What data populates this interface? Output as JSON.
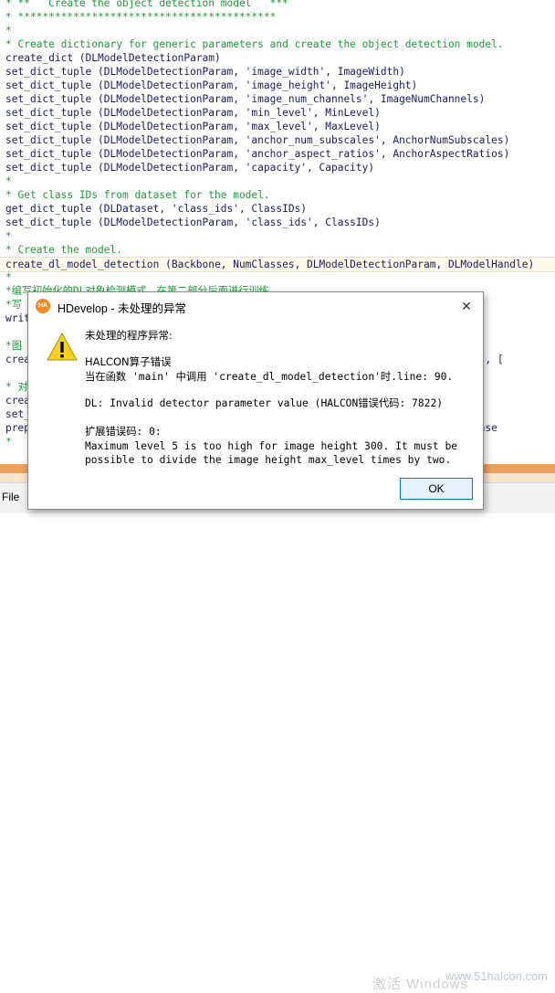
{
  "editor": {
    "lines": [
      {
        "text": "* **   Create the object detection model   ***",
        "kind": "c"
      },
      {
        "text": "* ******************************************",
        "kind": "c"
      },
      {
        "text": "*",
        "kind": "c"
      },
      {
        "text": "* Create dictionary for generic parameters and create the object detection model.",
        "kind": "c"
      },
      {
        "text": "create_dict (DLModelDetectionParam)",
        "kind": "n"
      },
      {
        "text": "set_dict_tuple (DLModelDetectionParam, 'image_width', ImageWidth)",
        "kind": "n"
      },
      {
        "text": "set_dict_tuple (DLModelDetectionParam, 'image_height', ImageHeight)",
        "kind": "n"
      },
      {
        "text": "set_dict_tuple (DLModelDetectionParam, 'image_num_channels', ImageNumChannels)",
        "kind": "n"
      },
      {
        "text": "set_dict_tuple (DLModelDetectionParam, 'min_level', MinLevel)",
        "kind": "n"
      },
      {
        "text": "set_dict_tuple (DLModelDetectionParam, 'max_level', MaxLevel)",
        "kind": "n"
      },
      {
        "text": "set_dict_tuple (DLModelDetectionParam, 'anchor_num_subscales', AnchorNumSubscales)",
        "kind": "n"
      },
      {
        "text": "set_dict_tuple (DLModelDetectionParam, 'anchor_aspect_ratios', AnchorAspectRatios)",
        "kind": "n"
      },
      {
        "text": "set_dict_tuple (DLModelDetectionParam, 'capacity', Capacity)",
        "kind": "n"
      },
      {
        "text": "*",
        "kind": "c"
      },
      {
        "text": "* Get class IDs from dataset for the model.",
        "kind": "c"
      },
      {
        "text": "get_dict_tuple (DLDataset, 'class_ids', ClassIDs)",
        "kind": "n"
      },
      {
        "text": "set_dict_tuple (DLModelDetectionParam, 'class_ids', ClassIDs)",
        "kind": "n"
      },
      {
        "text": "*",
        "kind": "c"
      },
      {
        "text": "* Create the model.",
        "kind": "c"
      },
      {
        "text": "create_dl_model_detection (Backbone, NumClasses, DLModelDetectionParam, DLModelHandle)",
        "kind": "n hl"
      },
      {
        "text": "*",
        "kind": "c"
      },
      {
        "text": "*编写初始化的DL对象检测模式，在第二部分后面进行训练。",
        "kind": "c"
      },
      {
        "text": "*写",
        "kind": "c"
      },
      {
        "text": "writ",
        "kind": "n"
      },
      {
        "text": "",
        "kind": "n"
      },
      {
        "text": "*图",
        "kind": "c"
      },
      {
        "text": "crea                                                                  , [], [], [",
        "kind": "n"
      },
      {
        "text": "",
        "kind": "n"
      },
      {
        "text": "* 对",
        "kind": "c"
      },
      {
        "text": "crea",
        "kind": "n"
      },
      {
        "text": "set_",
        "kind": "n"
      },
      {
        "text": "prep                                                                 m, DLDatase",
        "kind": "n"
      },
      {
        "text": "*",
        "kind": "c"
      }
    ]
  },
  "menubar": {
    "file_label": "File"
  },
  "watermark": {
    "text": "激活 Windows",
    "site": "www.51halcon.com"
  },
  "dialog": {
    "title": "HDevelop - 未处理的异常",
    "close_label": "✕",
    "icon": "warning-icon",
    "heading": "未处理的程序异常:",
    "error_title": "HALCON算子错误",
    "error_location": "当在函数 'main' 中调用 'create_dl_model_detection'时.line: 90.",
    "error_detail": "DL: Invalid detector parameter value (HALCON错误代码: 7822)",
    "extended_code": "扩展错误码: 0:",
    "extended_msg_1": "Maximum level 5 is too high for image height 300. It must be",
    "extended_msg_2": "possible to divide the image height max_level times by two.",
    "ok_label": "OK",
    "accent": "#0078d7"
  }
}
